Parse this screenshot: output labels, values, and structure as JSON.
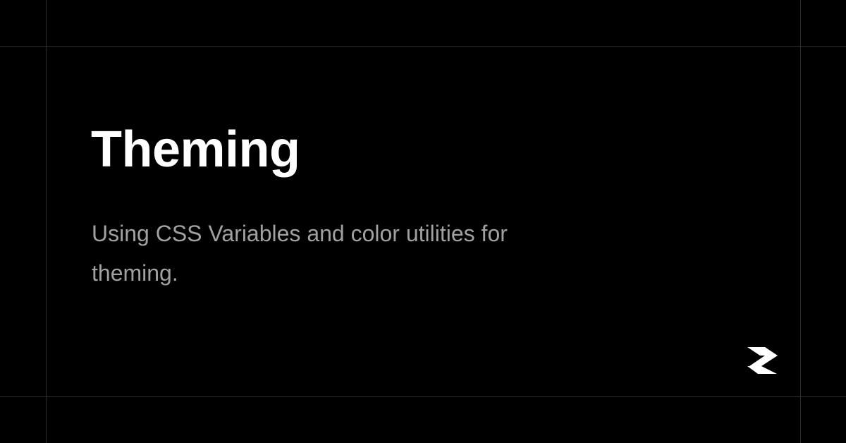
{
  "card": {
    "title": "Theming",
    "description": "Using CSS Variables and color utilities for theming.",
    "logo_icon": "brand-logo-icon"
  },
  "colors": {
    "background": "#000000",
    "grid_line": "#2e2e2e",
    "title": "#ffffff",
    "description": "#a1a1a1",
    "logo": "#ffffff"
  }
}
